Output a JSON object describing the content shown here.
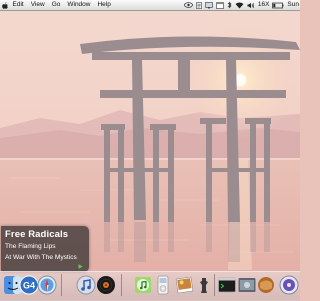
{
  "menubar": {
    "items": [
      "Edit",
      "View",
      "Go",
      "Window",
      "Help"
    ],
    "status": {
      "battery": "16X",
      "clock": "Sun"
    }
  },
  "now_playing": {
    "track": "Free Radicals",
    "artist": "The Flaming Lips",
    "album": "At War With The Mystics"
  },
  "dock": {
    "icons": [
      "finder-icon",
      "g4-badge-icon",
      "safari-compass-icon",
      "itunes-icon",
      "vinyl-record-icon",
      "music-cd-icon",
      "ipod-icon",
      "mail-icon",
      "photos-icon",
      "chess-icon",
      "system-preferences-icon",
      "terminal-icon",
      "stats-icon",
      "dashboard-icon",
      "trash-icon"
    ]
  },
  "colors": {
    "sky": "#f4d6cc",
    "water": "#e7b8b1",
    "torii": "#9a8a8f",
    "sun": "#fff3cc",
    "widget_bg": "#3c3634"
  }
}
